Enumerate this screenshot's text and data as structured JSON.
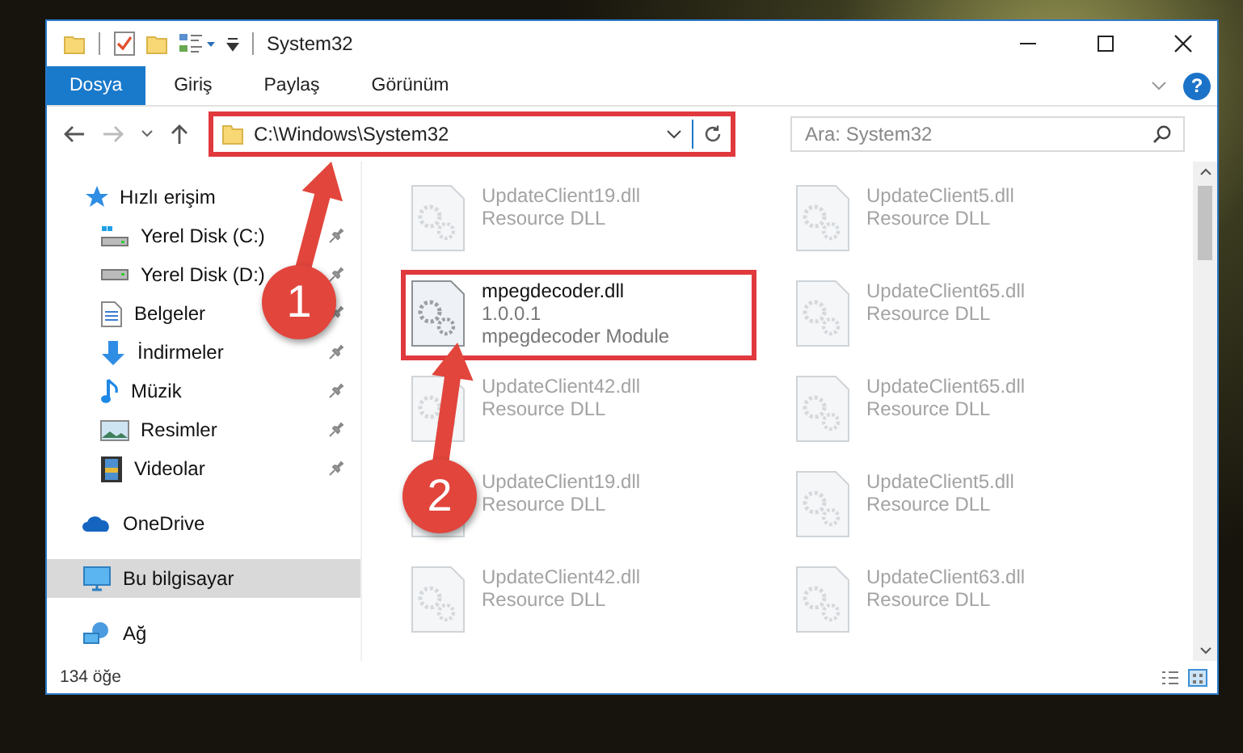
{
  "window": {
    "title": "System32"
  },
  "ribbon_tabs": [
    {
      "label": "Dosya",
      "selected": true
    },
    {
      "label": "Giriş",
      "selected": false
    },
    {
      "label": "Paylaş",
      "selected": false
    },
    {
      "label": "Görünüm",
      "selected": false
    }
  ],
  "help_button": {
    "label": "?"
  },
  "address_bar": {
    "path": "C:\\Windows\\System32",
    "highlighted": true
  },
  "search": {
    "placeholder": "Ara: System32"
  },
  "sidebar": {
    "items": [
      {
        "label": "Hızlı erişim",
        "kind": "star",
        "selected": false,
        "children": [
          {
            "label": "Yerel Disk (C:)",
            "kind": "system-drive",
            "pinned": true,
            "selected": false
          },
          {
            "label": "Yerel Disk (D:)",
            "kind": "drive",
            "pinned": true,
            "selected": false
          },
          {
            "label": "Belgeler",
            "kind": "documents",
            "pinned": true,
            "selected": false
          },
          {
            "label": "İndirmeler",
            "kind": "downloads",
            "pinned": true,
            "selected": false
          },
          {
            "label": "Müzik",
            "kind": "music",
            "pinned": true,
            "selected": false
          },
          {
            "label": "Resimler",
            "kind": "pictures",
            "pinned": true,
            "selected": false
          },
          {
            "label": "Videolar",
            "kind": "videos",
            "pinned": true,
            "selected": false
          }
        ]
      },
      {
        "label": "OneDrive",
        "kind": "cloud",
        "selected": false
      },
      {
        "label": "Bu bilgisayar",
        "kind": "computer",
        "selected": true
      },
      {
        "label": "Ağ",
        "kind": "network",
        "selected": false
      }
    ]
  },
  "files": [
    {
      "name": "UpdateClient19.dll",
      "details": [
        "Resource DLL"
      ],
      "blurred": true,
      "highlighted": false
    },
    {
      "name": "UpdateClient5.dll",
      "details": [
        "Resource DLL"
      ],
      "blurred": true,
      "highlighted": false
    },
    {
      "name": "mpegdecoder.dll",
      "details": [
        "1.0.0.1",
        "mpegdecoder Module"
      ],
      "blurred": false,
      "highlighted": true
    },
    {
      "name": "UpdateClient65.dll",
      "details": [
        "Resource DLL"
      ],
      "blurred": true,
      "highlighted": false
    },
    {
      "name": "UpdateClient42.dll",
      "details": [
        "Resource DLL"
      ],
      "blurred": true,
      "highlighted": false
    },
    {
      "name": "UpdateClient65.dll",
      "details": [
        "Resource DLL"
      ],
      "blurred": true,
      "highlighted": false
    },
    {
      "name": "UpdateClient19.dll",
      "details": [
        "Resource DLL"
      ],
      "blurred": true,
      "highlighted": false
    },
    {
      "name": "UpdateClient5.dll",
      "details": [
        "Resource DLL"
      ],
      "blurred": true,
      "highlighted": false
    },
    {
      "name": "UpdateClient42.dll",
      "details": [
        "Resource DLL"
      ],
      "blurred": true,
      "highlighted": false
    },
    {
      "name": "UpdateClient63.dll",
      "details": [
        "Resource DLL"
      ],
      "blurred": true,
      "highlighted": false
    }
  ],
  "status_bar": {
    "item_count": "134 öğe"
  },
  "callouts": [
    {
      "number": "1"
    },
    {
      "number": "2"
    }
  ]
}
